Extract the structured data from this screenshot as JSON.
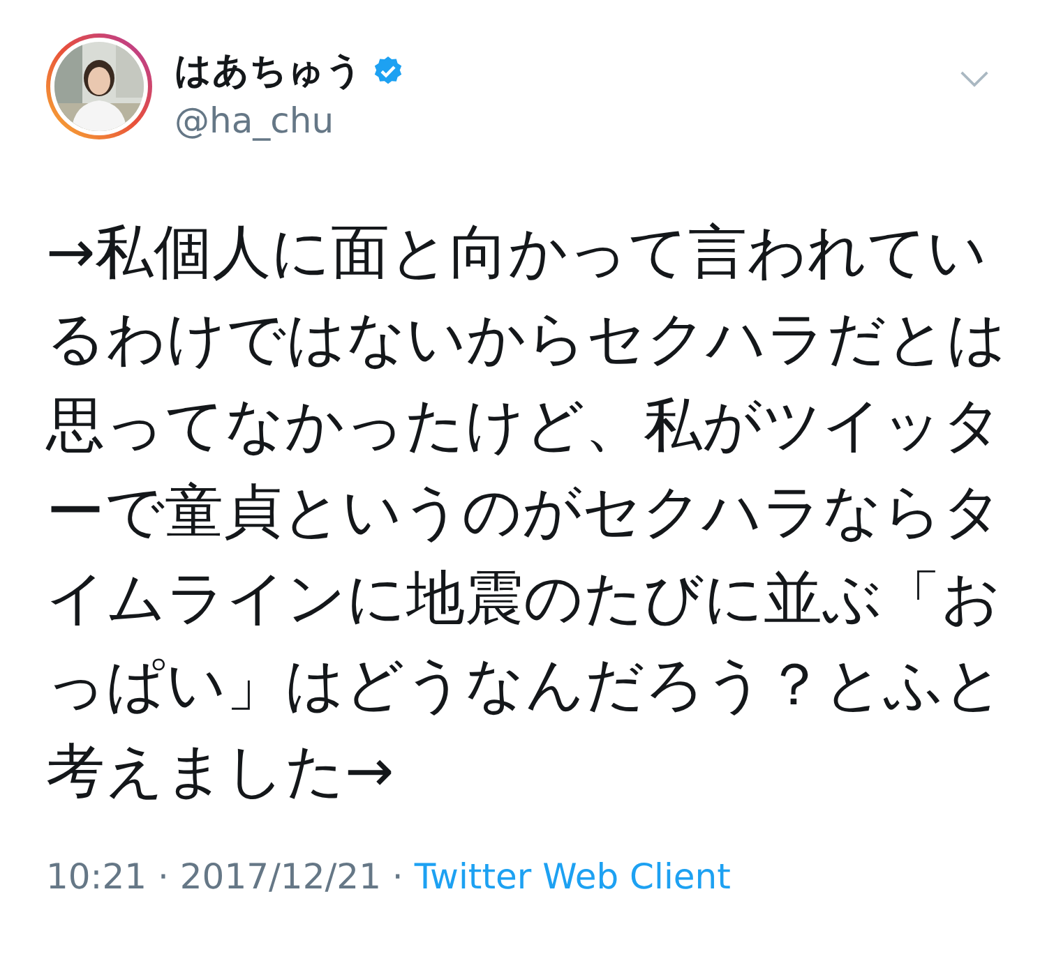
{
  "tweet": {
    "author": {
      "name": "はあちゅう",
      "handle": "@ha_chu",
      "verified": true
    },
    "text": "→私個人に面と向かって言われているわけではないからセクハラだとは思ってなかったけど、私がツイッターで童貞というのがセクハラならタイムラインに地震のたびに並ぶ「おっぱい」はどうなんだろう？とふと考えました→",
    "meta": {
      "info": "10:21 · 2017/12/21 ·",
      "source": "Twitter Web Client"
    }
  }
}
